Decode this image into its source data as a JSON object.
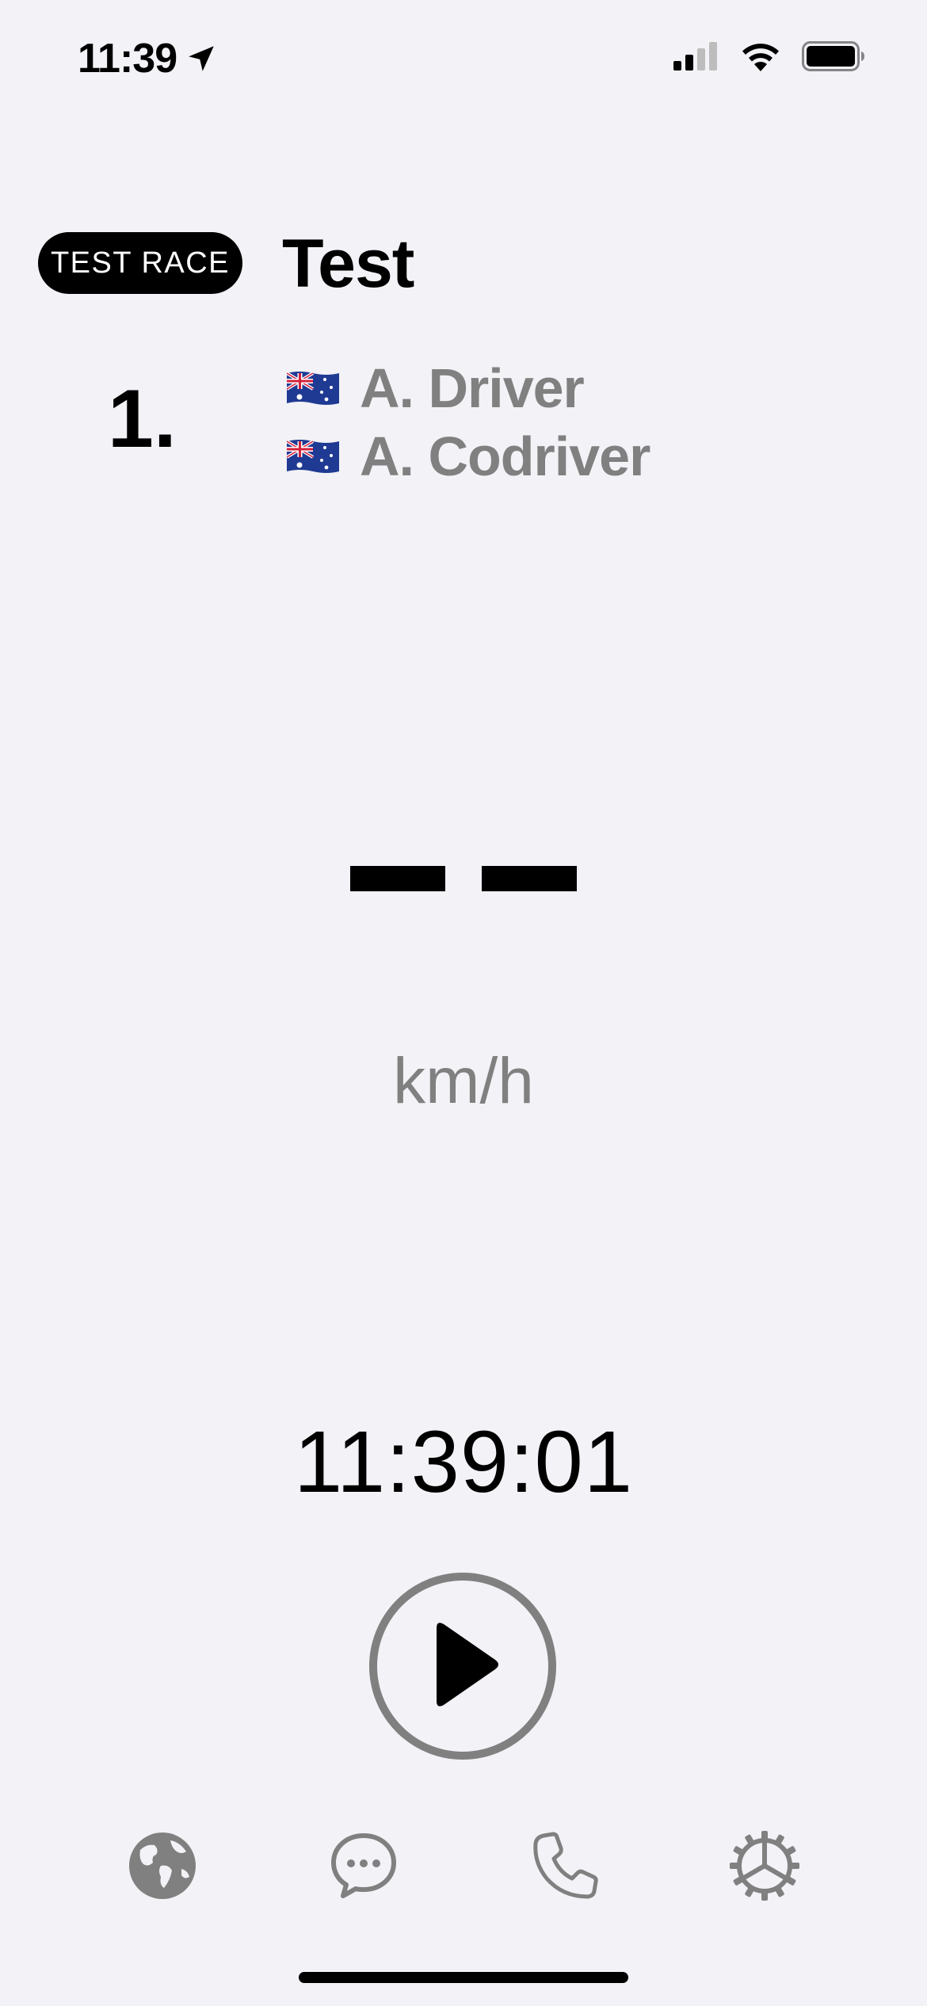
{
  "status_bar": {
    "time": "11:39",
    "icons": [
      "location-arrow-icon",
      "cellular-signal-icon",
      "wifi-icon",
      "battery-icon"
    ]
  },
  "header": {
    "badge": "TEST RACE",
    "title": "Test"
  },
  "crew": {
    "position": "1.",
    "driver": {
      "name": "A. Driver",
      "flag": "australia-flag-icon"
    },
    "codriver": {
      "name": "A. Codriver",
      "flag": "australia-flag-icon"
    }
  },
  "speed": {
    "value": "",
    "unit": "km/h"
  },
  "clock": "11:39:01",
  "controls": {
    "play_icon": "play-icon"
  },
  "tab_bar": {
    "items": [
      "globe-icon",
      "chat-bubble-icon",
      "phone-icon",
      "settings-gear-icon"
    ]
  },
  "colors": {
    "background": "#f2f2f7",
    "secondary_text": "#808080",
    "primary_text": "#000000"
  }
}
